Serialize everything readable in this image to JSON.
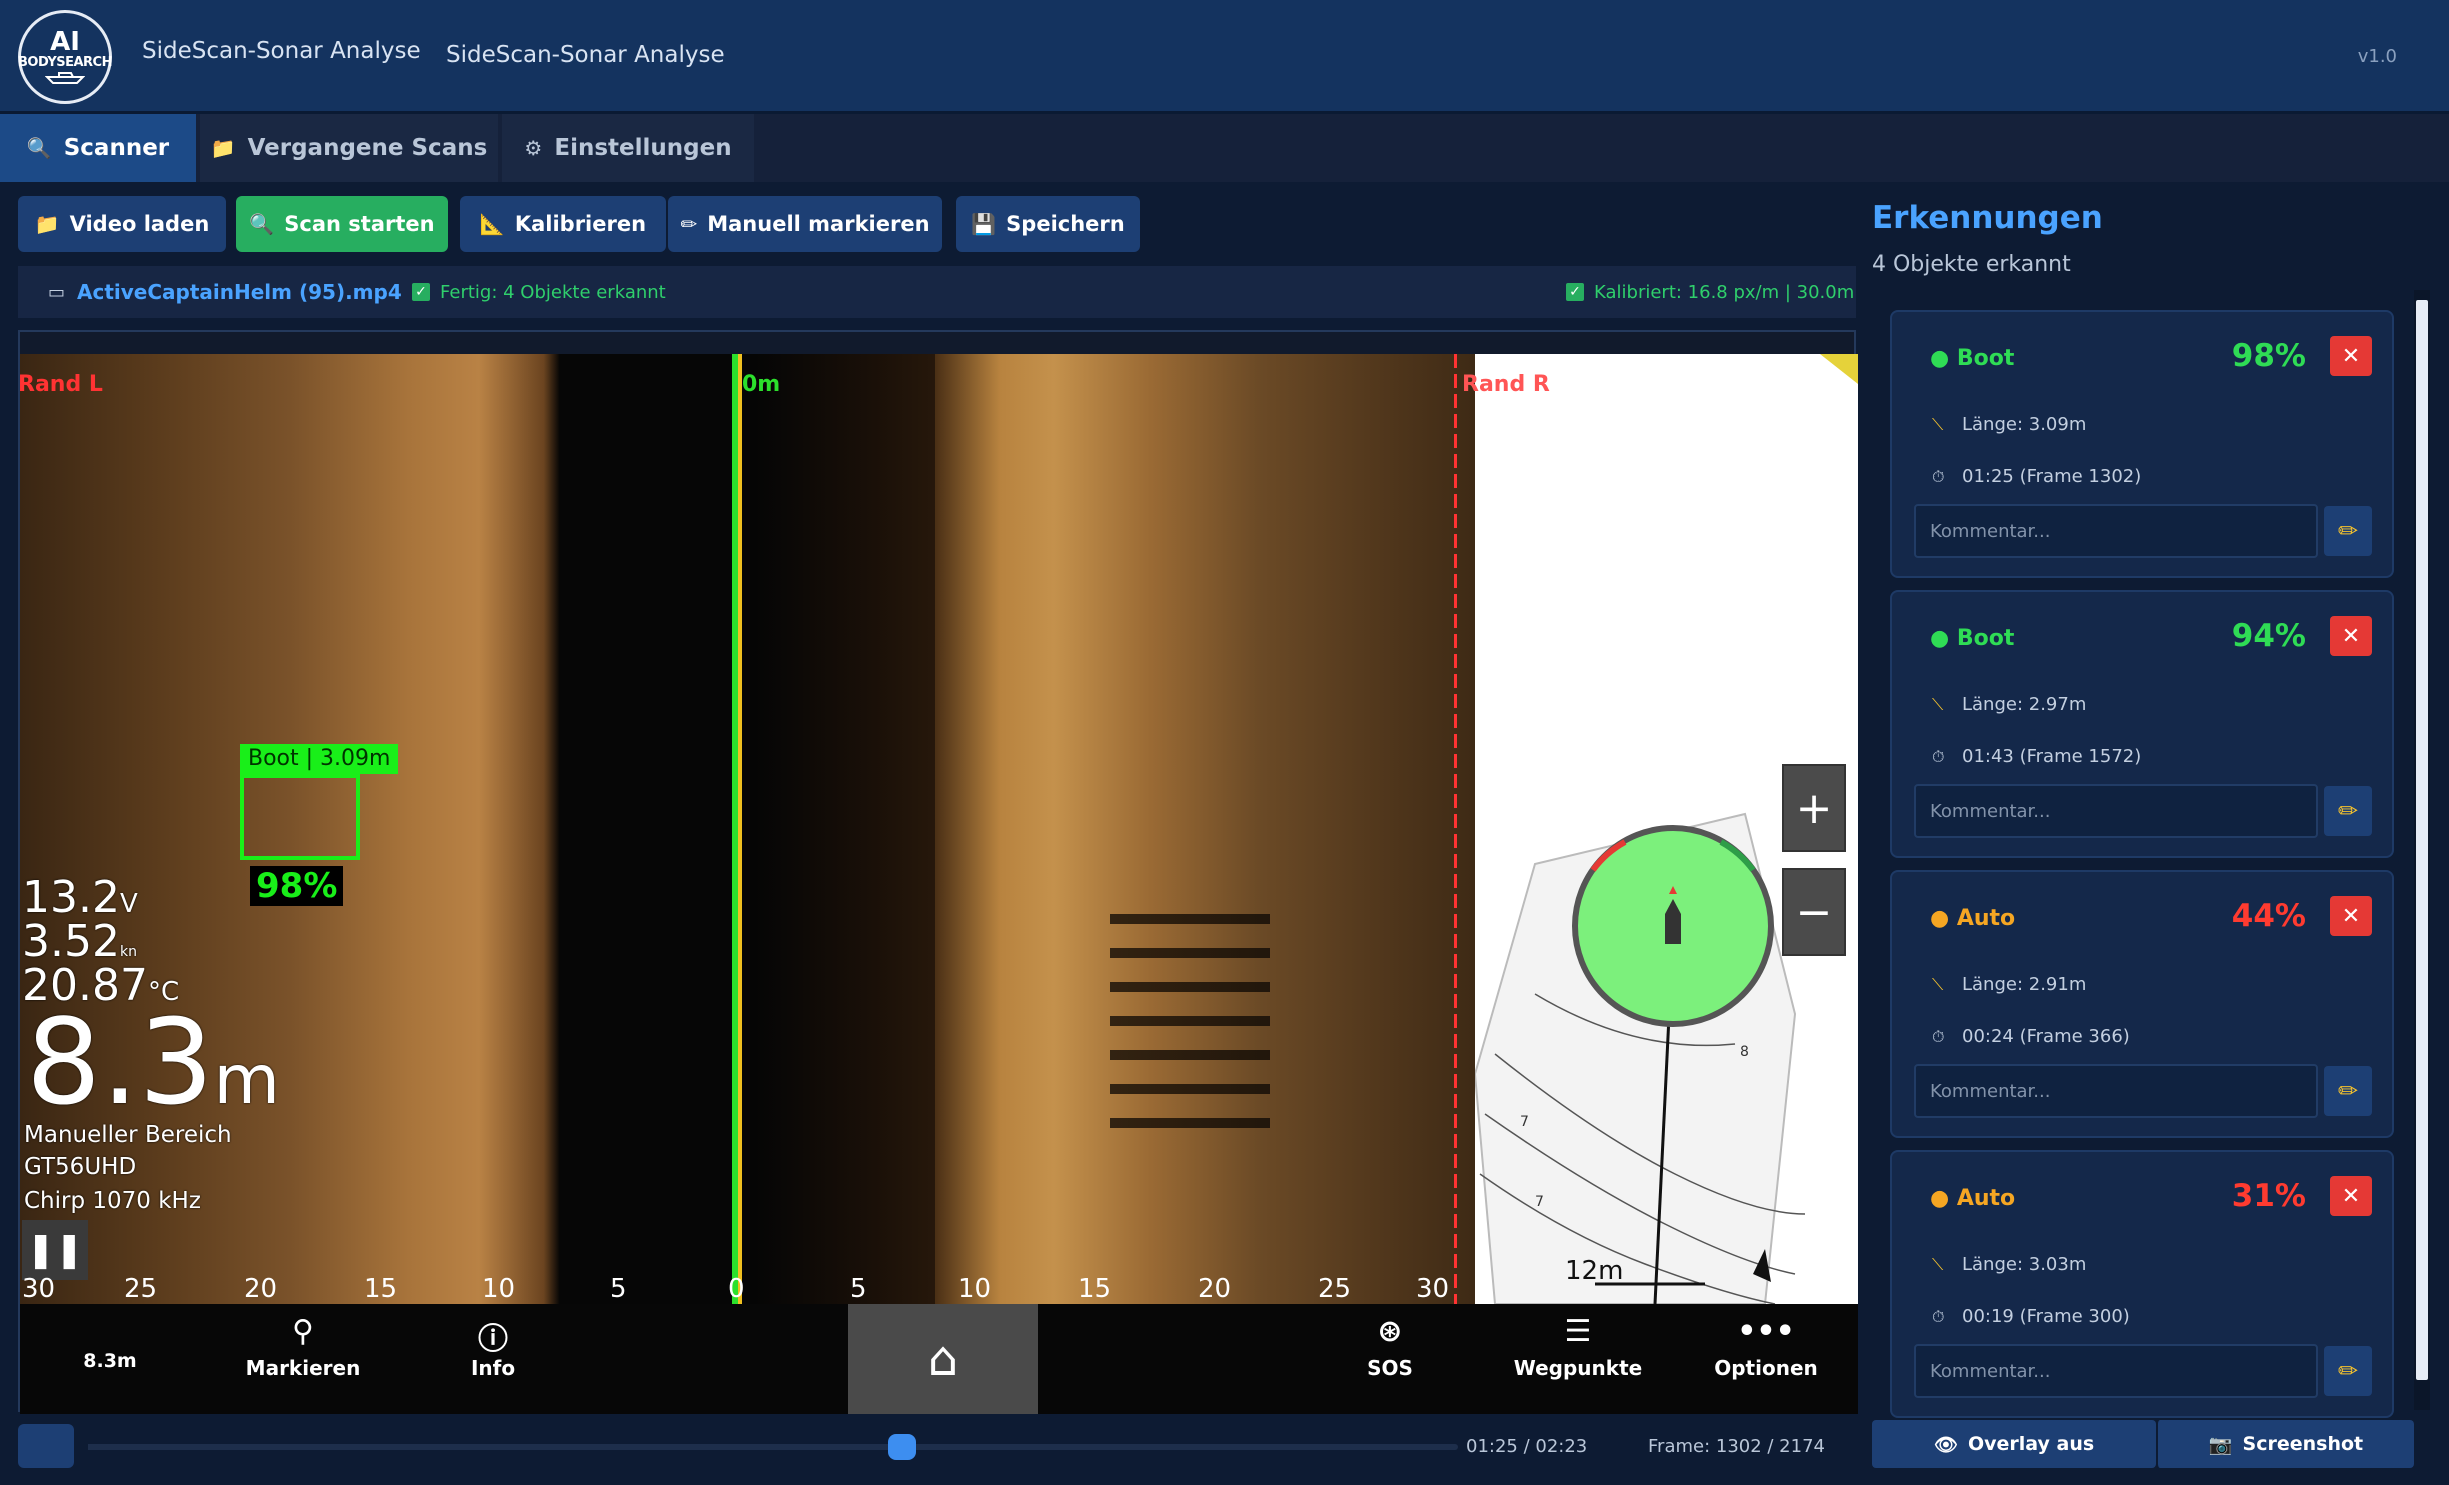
{
  "header": {
    "logo_line1": "AI",
    "logo_line2": "BODYSEARCH",
    "title1": "SideScan-Sonar Analyse",
    "title2": "SideScan-Sonar Analyse",
    "version": "v1.0"
  },
  "tabs": [
    {
      "label": "Scanner",
      "icon": "search-icon",
      "active": true
    },
    {
      "label": "Vergangene Scans",
      "icon": "folder-icon",
      "active": false
    },
    {
      "label": "Einstellungen",
      "icon": "gear-icon",
      "active": false
    }
  ],
  "toolbar": {
    "load_video": "Video laden",
    "start_scan": "Scan starten",
    "calibrate": "Kalibrieren",
    "manual_mark": "Manuell markieren",
    "save": "Speichern"
  },
  "status": {
    "file_name": "ActiveCaptainHelm (95).mp4",
    "scan_status": "Fertig: 4 Objekte erkannt",
    "calibration": "Kalibriert: 16.8 px/m | 30.0m"
  },
  "sonar": {
    "edge_left": "Rand L",
    "center": "0m",
    "edge_right": "Rand R",
    "voltage": "13.2",
    "voltage_unit": "V",
    "speed": "3.52",
    "speed_unit": "kn",
    "temperature": "20.87",
    "temp_unit": "°C",
    "depth": "8.3",
    "depth_unit": "m",
    "mode": "Manueller Bereich",
    "device": "GT56UHD",
    "frequency": "Chirp 1070 kHz",
    "scale_left": [
      "30",
      "25",
      "20",
      "15",
      "10",
      "5",
      "0"
    ],
    "scale_right": [
      "5",
      "10",
      "15",
      "20",
      "25",
      "30"
    ],
    "bottom_depth": "8.3m",
    "menu": {
      "mark": "Markieren",
      "info": "Info",
      "sos": "SOS",
      "waypoints": "Wegpunkte",
      "options": "Optionen"
    },
    "map_distance": "12m",
    "contour_labels": [
      "8",
      "7",
      "7"
    ],
    "detection": {
      "label": "Boot | 3.09m",
      "confidence": "98%"
    }
  },
  "timeline": {
    "time": "01:25 / 02:23",
    "frame": "Frame: 1302 / 2174",
    "progress": 0.594
  },
  "panel": {
    "title": "Erkennungen",
    "subtitle": "4 Objekte erkannt",
    "comment_placeholder": "Kommentar...",
    "detections": [
      {
        "name": "● Boot",
        "confidence": "98%",
        "length": "Länge: 3.09m",
        "time": "01:25 (Frame 1302)",
        "name_color": "#2fdc55",
        "pct_color": "#2fdc55"
      },
      {
        "name": "● Boot",
        "confidence": "94%",
        "length": "Länge: 2.97m",
        "time": "01:43 (Frame 1572)",
        "name_color": "#2fdc55",
        "pct_color": "#2fdc55"
      },
      {
        "name": "● Auto",
        "confidence": "44%",
        "length": "Länge: 2.91m",
        "time": "00:24 (Frame 366)",
        "name_color": "#f5a623",
        "pct_color": "#ff3b30"
      },
      {
        "name": "● Auto",
        "confidence": "31%",
        "length": "Länge: 3.03m",
        "time": "00:19 (Frame 300)",
        "name_color": "#f5a623",
        "pct_color": "#ff3b30"
      }
    ],
    "overlay_btn": "Overlay aus",
    "screenshot_btn": "Screenshot"
  }
}
